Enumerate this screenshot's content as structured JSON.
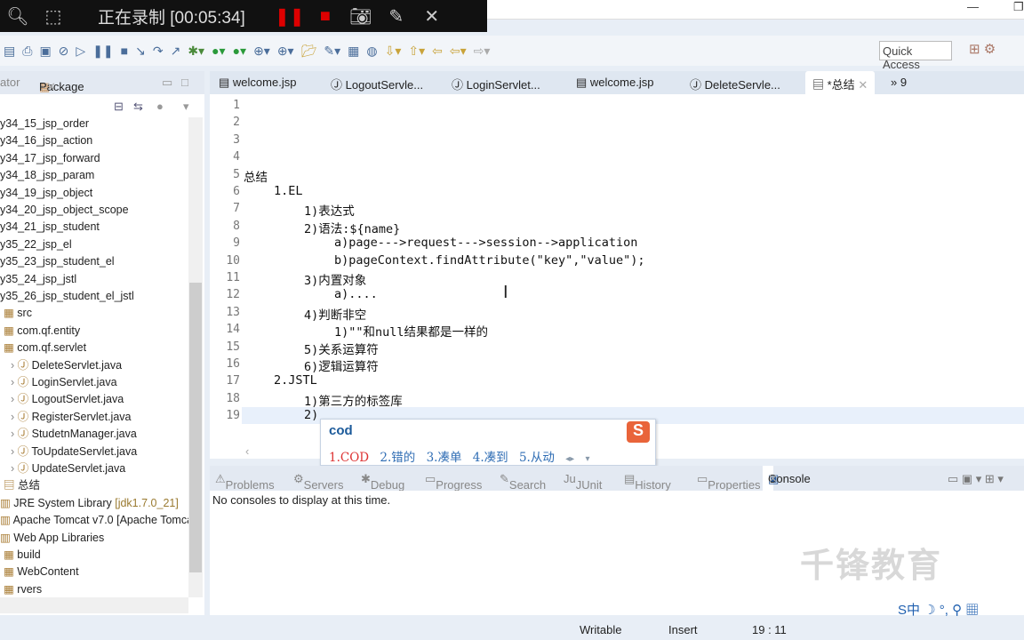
{
  "recorder": {
    "status": "正在录制 [00:05:34]"
  },
  "toolbar": {
    "quick_access": "Quick Access"
  },
  "left_panel": {
    "tabs": [
      "ator",
      "Package Ex..."
    ],
    "tree": [
      {
        "label": "y34_15_jsp_order",
        "type": "project"
      },
      {
        "label": "y34_16_jsp_action",
        "type": "project"
      },
      {
        "label": "y34_17_jsp_forward",
        "type": "project"
      },
      {
        "label": "y34_18_jsp_param",
        "type": "project"
      },
      {
        "label": "y34_19_jsp_object",
        "type": "project"
      },
      {
        "label": "y34_20_jsp_object_scope",
        "type": "project"
      },
      {
        "label": "y34_21_jsp_student",
        "type": "project"
      },
      {
        "label": "y35_22_jsp_el",
        "type": "project"
      },
      {
        "label": "y35_23_jsp_student_el",
        "type": "project"
      },
      {
        "label": "y35_24_jsp_jstl",
        "type": "project"
      },
      {
        "label": "y35_26_jsp_student_el_jstl",
        "type": "project"
      },
      {
        "label": "src",
        "type": "folder"
      },
      {
        "label": "com.qf.entity",
        "type": "package"
      },
      {
        "label": "com.qf.servlet",
        "type": "package"
      },
      {
        "label": "DeleteServlet.java",
        "type": "java"
      },
      {
        "label": "LoginServlet.java",
        "type": "java"
      },
      {
        "label": "LogoutServlet.java",
        "type": "java"
      },
      {
        "label": "RegisterServlet.java",
        "type": "java"
      },
      {
        "label": "StudetnManager.java",
        "type": "java"
      },
      {
        "label": "ToUpdateServlet.java",
        "type": "java"
      },
      {
        "label": "UpdateServlet.java",
        "type": "java"
      },
      {
        "label": "总结",
        "type": "file"
      },
      {
        "label": "JRE System Library",
        "suffix": "[jdk1.7.0_21]",
        "type": "lib"
      },
      {
        "label": "Apache Tomcat v7.0 [Apache Tomca",
        "type": "lib"
      },
      {
        "label": "Web App Libraries",
        "type": "lib"
      },
      {
        "label": "build",
        "type": "folder"
      },
      {
        "label": "WebContent",
        "type": "folder"
      },
      {
        "label": "rvers",
        "type": "folder"
      }
    ]
  },
  "editor": {
    "tabs": [
      "welcome.jsp",
      "LogoutServle...",
      "LoginServlet...",
      "welcome.jsp",
      "DeleteServle...",
      "*总结"
    ],
    "overflow": "9",
    "lines": [
      {
        "n": "1",
        "indent": 0,
        "text": ""
      },
      {
        "n": "2",
        "indent": 0,
        "text": ""
      },
      {
        "n": "3",
        "indent": 0,
        "text": ""
      },
      {
        "n": "4",
        "indent": 0,
        "text": ""
      },
      {
        "n": "5",
        "indent": 0,
        "text": "总结"
      },
      {
        "n": "6",
        "indent": 1,
        "text": "1.EL"
      },
      {
        "n": "7",
        "indent": 2,
        "text": "1)表达式"
      },
      {
        "n": "8",
        "indent": 2,
        "text": "2)语法:${name}"
      },
      {
        "n": "9",
        "indent": 3,
        "text": "a)page--->request--->session-->application"
      },
      {
        "n": "10",
        "indent": 3,
        "text": "b)pageContext.findAttribute(\"key\",\"value\");"
      },
      {
        "n": "11",
        "indent": 2,
        "text": "3)内置对象"
      },
      {
        "n": "12",
        "indent": 3,
        "text": "a)...."
      },
      {
        "n": "13",
        "indent": 2,
        "text": "4)判断非空"
      },
      {
        "n": "14",
        "indent": 3,
        "text": "1)\"\"和null结果都是一样的"
      },
      {
        "n": "15",
        "indent": 2,
        "text": "5)关系运算符"
      },
      {
        "n": "16",
        "indent": 2,
        "text": "6)逻辑运算符"
      },
      {
        "n": "17",
        "indent": 1,
        "text": "2.JSTL"
      },
      {
        "n": "18",
        "indent": 2,
        "text": "1)第三方的标签库"
      },
      {
        "n": "19",
        "indent": 2,
        "text": "2)"
      }
    ]
  },
  "ime": {
    "input": "cod",
    "logo": "S",
    "candidates": [
      "1.COD",
      "2.错的",
      "3.凑单",
      "4.凑到",
      "5.从动"
    ]
  },
  "bottom_panel": {
    "tabs": [
      "Problems",
      "Servers",
      "Debug",
      "Progress",
      "Search",
      "JUnit",
      "History",
      "Properties",
      "Console"
    ],
    "message": "No consoles to display at this time."
  },
  "watermark": "千锋教育",
  "ime_bar": "S中 ☽ °, ⚲ ▦",
  "status": {
    "writable": "Writable",
    "mode": "Insert",
    "position": "19 : 11"
  }
}
